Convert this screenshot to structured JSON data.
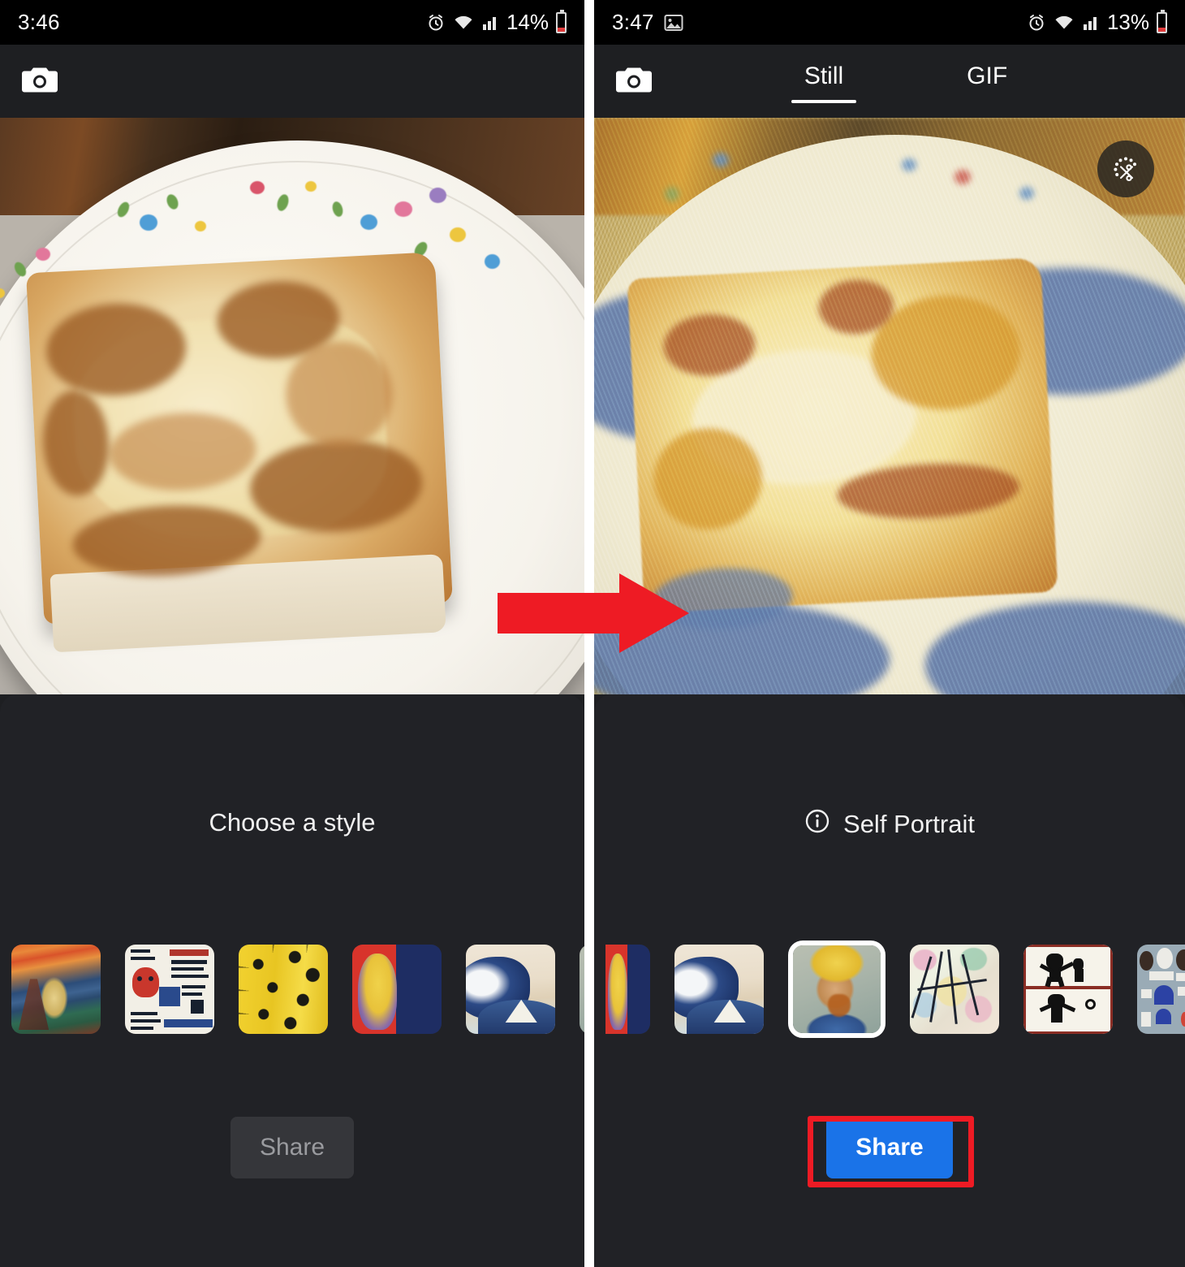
{
  "meta": {
    "accent_blue": "#1a73e8",
    "highlight_red": "#ee1b24",
    "sheet_bg": "#212226",
    "panel_bg": "#1e1f22",
    "statusbar_bg": "#000000"
  },
  "left_panel": {
    "status_bar": {
      "time": "3:46",
      "battery_percent": "14%",
      "icons": [
        "alarm-icon",
        "wifi-icon",
        "signal-icon",
        "battery-icon"
      ]
    },
    "app_bar": {
      "camera_icon": "camera-icon",
      "tabs": []
    },
    "photo": {
      "description": "toast on floral plate",
      "crop_button": null
    },
    "sheet": {
      "title": "Choose a style",
      "has_info_icon": false,
      "styles": [
        {
          "name": "The Scream",
          "art": "a-scream",
          "selected": false,
          "clip": "none"
        },
        {
          "name": "Basquiat",
          "art": "a-basquiat",
          "selected": false,
          "clip": "none"
        },
        {
          "name": "Klee Yellow",
          "art": "a-klee",
          "selected": false,
          "clip": "none"
        },
        {
          "name": "Warhol",
          "art": "a-warhol",
          "selected": false,
          "clip": "none"
        },
        {
          "name": "The Great Wave",
          "art": "a-wave",
          "selected": false,
          "clip": "none"
        },
        {
          "name": "Self Portrait",
          "art": "a-vangogh",
          "selected": false,
          "clip": "right"
        }
      ],
      "share_label": "Share",
      "share_enabled": false
    }
  },
  "right_panel": {
    "status_bar": {
      "time": "3:47",
      "battery_percent": "13%",
      "icons": [
        "image-icon",
        "alarm-icon",
        "wifi-icon",
        "signal-icon",
        "battery-icon"
      ]
    },
    "app_bar": {
      "camera_icon": "camera-icon",
      "tabs": [
        {
          "label": "Still",
          "active": true
        },
        {
          "label": "GIF",
          "active": false
        }
      ]
    },
    "photo": {
      "description": "toast restyled as Van Gogh painting",
      "crop_button": "crop-scissors-icon"
    },
    "sheet": {
      "title": "Self Portrait",
      "has_info_icon": true,
      "styles": [
        {
          "name": "Warhol",
          "art": "a-warhol",
          "selected": false,
          "clip": "left"
        },
        {
          "name": "The Great Wave",
          "art": "a-wave",
          "selected": false,
          "clip": "none"
        },
        {
          "name": "Self Portrait",
          "art": "a-vangogh",
          "selected": true,
          "clip": "none"
        },
        {
          "name": "Kandinsky",
          "art": "a-kandinsky",
          "selected": false,
          "clip": "none"
        },
        {
          "name": "Keith Haring",
          "art": "a-haring",
          "selected": false,
          "clip": "none"
        },
        {
          "name": "Leger Abstract",
          "art": "a-leger",
          "selected": false,
          "clip": "right"
        }
      ],
      "share_label": "Share",
      "share_enabled": true
    }
  },
  "annotations": {
    "arrow": {
      "name": "red-right-arrow",
      "color": "#ee1b24"
    },
    "highlight_box": {
      "name": "share-button-highlight",
      "color": "#ee1b24"
    }
  }
}
